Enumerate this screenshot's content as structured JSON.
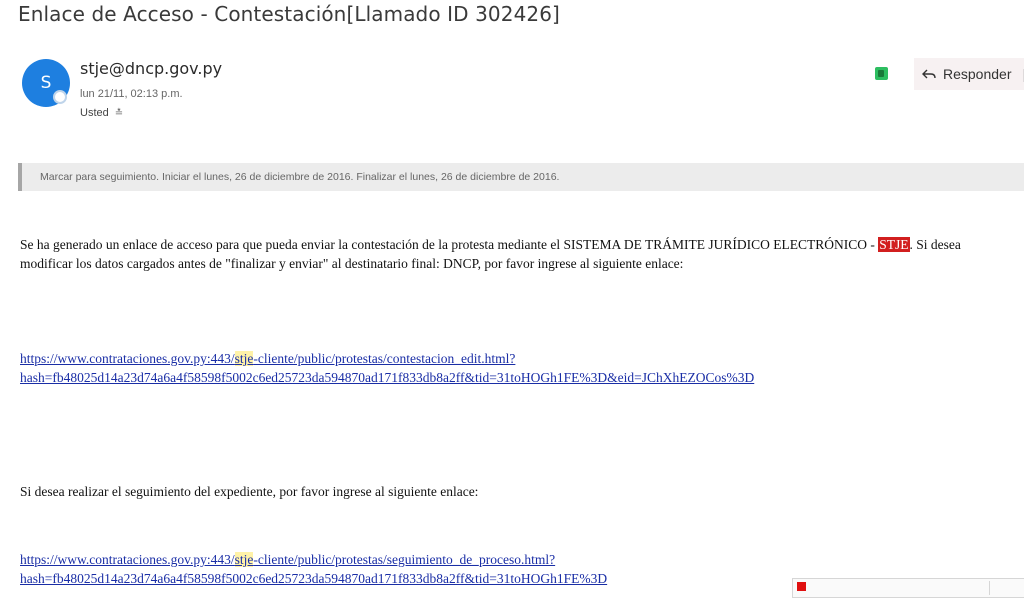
{
  "email": {
    "subject": "Enlace de Acceso - Contestación[Llamado ID 302426]",
    "avatar_initial": "S",
    "sender": "stje@dncp.gov.py",
    "datetime": "lun 21/11, 02:13 p.m.",
    "recipient": "Usted",
    "reply_label": "Responder",
    "followup_banner": "Marcar para seguimiento. Iniciar el lunes, 26 de diciembre de 2016. Finalizar el lunes, 26 de diciembre de 2016."
  },
  "body": {
    "p1_part1": "Se ha generado un enlace de acceso para que pueda enviar la contestación de la protesta mediante el SISTEMA DE TRÁMITE JURÍDICO ELECTRÓNICO - ",
    "p1_highlight": "STJE",
    "p1_part2": ". Si desea modificar los datos cargados antes de \"finalizar y enviar\" al destinatario final: DNCP, por favor ingrese al siguiente enlace:",
    "link1_a": "https://www.contrataciones.gov.py:443/",
    "link1_hl": "stje",
    "link1_b": "-cliente/public/protestas/contestacion_edit.html?",
    "link1_c": "hash=fb48025d14a23d74a6a4f58598f5002c6ed25723da594870ad171f833db8a2ff&tid=31toHOGh1FE%3D&eid=JChXhEZOCos%3D",
    "p2": "Si desea realizar el seguimiento del expediente, por favor ingrese al siguiente enlace:",
    "link2_a": "https://www.contrataciones.gov.py:443/",
    "link2_hl": "stje",
    "link2_b": "-cliente/public/protestas/seguimiento_de_proceso.html?",
    "link2_c": "hash=fb48025d14a23d74a6a4f58598f5002c6ed25723da594870ad171f833db8a2ff&tid=31toHOGh1FE%3D"
  },
  "colors": {
    "avatar": "#1e7fe0",
    "highlight_red": "#d21f1f",
    "highlight_yellow": "#fff2a8",
    "link": "#1a2ea6"
  },
  "icons": [
    "evernote-icon",
    "reply-arrow-icon",
    "chevron-down-icon",
    "flag-icon"
  ]
}
